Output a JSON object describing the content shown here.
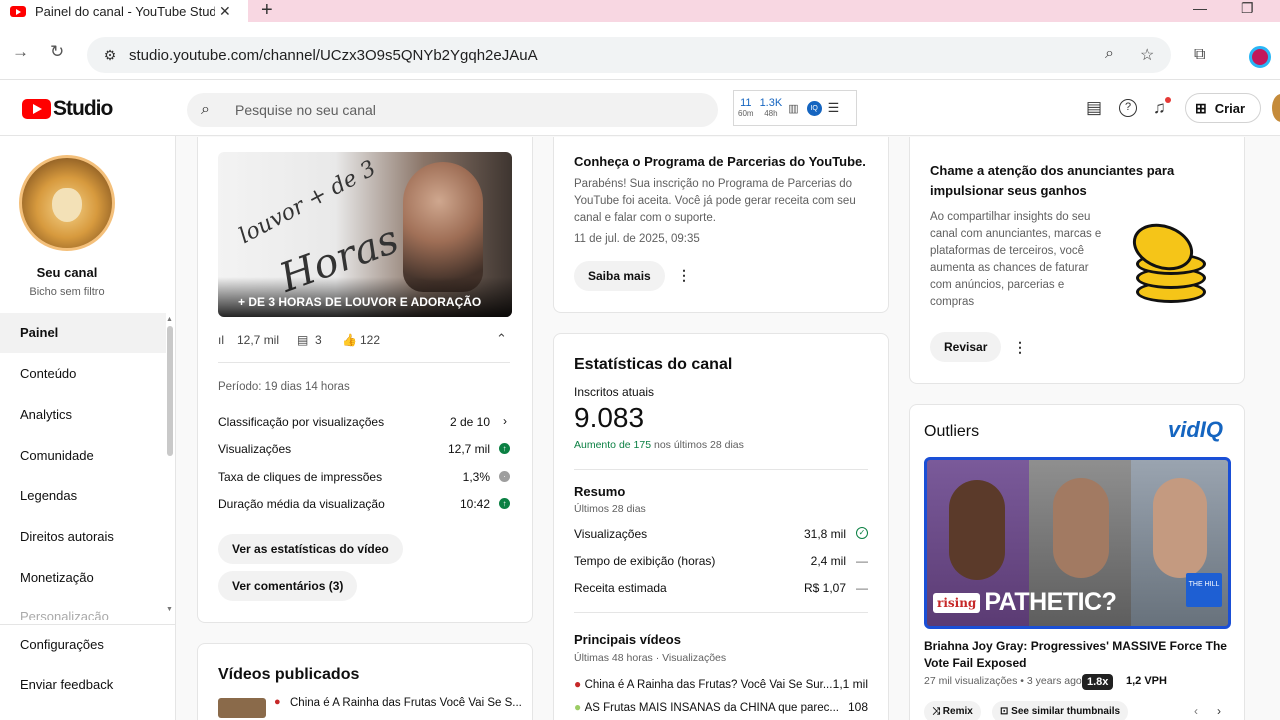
{
  "browser": {
    "tab_title": "Painel do canal - YouTube Studi",
    "tab_close": "✕",
    "new_tab": "+",
    "url": "studio.youtube.com/channel/UCzx3O9s5QNYb2Ygqh2eJAuA",
    "minimize": "—",
    "restore": "❐"
  },
  "header": {
    "logo_text": "Studio",
    "search_placeholder": "Pesquise no seu canal",
    "vidiq": {
      "stat1_value": "11",
      "stat1_label": "60m",
      "stat2_value": "1.3K",
      "stat2_label": "48h"
    },
    "create_label": "Criar"
  },
  "sidebar": {
    "channel_name": "Seu canal",
    "channel_handle": "Bicho sem filtro",
    "items": [
      "Painel",
      "Conteúdo",
      "Analytics",
      "Comunidade",
      "Legendas",
      "Direitos autorais",
      "Monetização"
    ],
    "partial_item": "Personalização",
    "bottom_items": [
      "Configurações",
      "Enviar feedback"
    ]
  },
  "latest_video": {
    "thumb_script_1": "louvor + de 3",
    "thumb_script_2": "Horas",
    "thumb_caption": "+ DE 3 HORAS DE LOUVOR E ADORAÇÃO",
    "views": "12,7 mil",
    "comments": "3",
    "likes": "122",
    "period": "Período: 19 dias 14 horas",
    "metrics": [
      {
        "label": "Classificação por visualizações",
        "value": "2 de 10"
      },
      {
        "label": "Visualizações",
        "value": "12,7 mil"
      },
      {
        "label": "Taxa de cliques de impressões",
        "value": "1,3%"
      },
      {
        "label": "Duração média da visualização",
        "value": "10:42"
      }
    ],
    "btn_stats": "Ver as estatísticas do vídeo",
    "btn_comments": "Ver comentários (3)"
  },
  "published": {
    "title": "Vídeos publicados",
    "first_item": "China é A Rainha das Frutas Você Vai Se S..."
  },
  "news": {
    "title": "Conheça o Programa de Parcerias do YouTube.",
    "body": "Parabéns! Sua inscrição no Programa de Parcerias do YouTube foi aceita. Você já pode gerar receita com seu canal e falar com o suporte.",
    "date": "11 de jul. de 2025, 09:35",
    "button": "Saiba mais"
  },
  "channel_stats": {
    "title": "Estatísticas do canal",
    "subs_label": "Inscritos atuais",
    "subs_value": "9.083",
    "growth_prefix": "Aumento de 175",
    "growth_suffix": "nos últimos 28 dias",
    "summary_title": "Resumo",
    "summary_period": "Últimos 28 dias",
    "summary": [
      {
        "label": "Visualizações",
        "value": "31,8 mil"
      },
      {
        "label": "Tempo de exibição (horas)",
        "value": "2,4 mil"
      },
      {
        "label": "Receita estimada",
        "value": "R$ 1,07"
      }
    ],
    "top_title": "Principais vídeos",
    "top_period": "Últimas 48 horas · Visualizações",
    "top_videos": [
      {
        "title": "China é A Rainha das Frutas? Você Vai Se Sur...",
        "value": "1,1 mil"
      },
      {
        "title": "AS Frutas MAIS INSANAS da CHINA que parec...",
        "value": "108"
      }
    ]
  },
  "ad_card": {
    "title": "Chame a atenção dos anunciantes para impulsionar seus ganhos",
    "body": "Ao compartilhar insights do seu canal com anunciantes, marcas e plataformas de terceiros, você aumenta as chances de faturar com anúncios, parcerias e compras",
    "button": "Revisar"
  },
  "outliers": {
    "title": "Outliers",
    "brand": "vidIQ",
    "thumb_text": "PATHETIC?",
    "thumb_tag": "rising",
    "thumb_logo": "THE HILL",
    "video_title": "Briahna Joy Gray: Progressives' MASSIVE Force The Vote Fail Exposed",
    "meta": "27 mil visualizações • 3 years ago",
    "multiplier": "1.8x",
    "vph": "1,2 VPH",
    "btn_remix": "Remix",
    "btn_similar": "See similar thumbnails"
  },
  "colors": {
    "youtube_red": "#ff0000",
    "positive_green": "#0b8043",
    "vidiq_blue": "#1565c0"
  }
}
